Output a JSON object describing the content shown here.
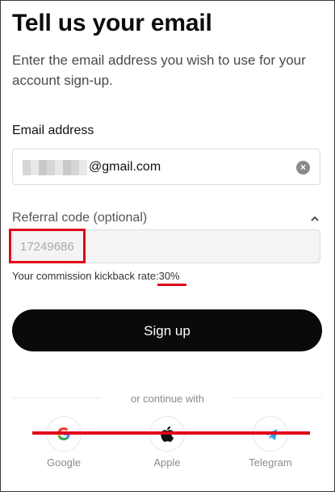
{
  "header": {
    "title": "Tell us your email",
    "subtitle": "Enter the email address you wish to use for your account sign-up."
  },
  "email": {
    "label": "Email address",
    "value_visible": "@gmail.com",
    "clear_icon": "clear-circle-icon"
  },
  "referral": {
    "label": "Referral code (optional)",
    "value": "17249686",
    "toggle_icon": "chevron-up-icon",
    "commission_text": "Your commission kickback rate:",
    "commission_rate": "30%"
  },
  "actions": {
    "signup_label": "Sign up"
  },
  "social": {
    "divider_text": "or continue with",
    "providers": [
      {
        "name": "Google",
        "icon": "google-icon"
      },
      {
        "name": "Apple",
        "icon": "apple-icon"
      },
      {
        "name": "Telegram",
        "icon": "telegram-icon"
      }
    ]
  },
  "annotations": {
    "highlight_color": "#e0001b"
  },
  "colors": {
    "primary_button": "#0a0a0a",
    "muted_text": "#8c8c8c"
  }
}
